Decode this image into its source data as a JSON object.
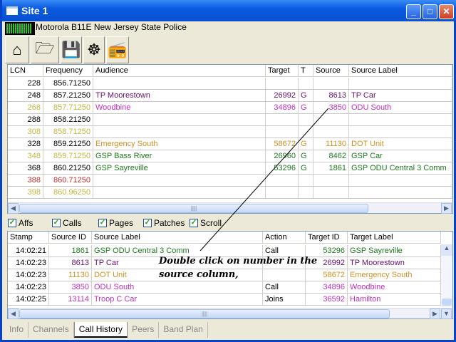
{
  "window": {
    "title": "Site 1"
  },
  "status": {
    "station": "Motorola B11E New Jersey State Police",
    "signal_bars": 12
  },
  "toolbar": [
    {
      "name": "home-icon",
      "glyph": "⌂"
    },
    {
      "name": "folder-open-icon",
      "glyph": "🗁"
    },
    {
      "name": "save-icon",
      "glyph": "💾"
    },
    {
      "name": "wheel-settings-icon",
      "glyph": "☸"
    },
    {
      "name": "radio-scanner-icon",
      "glyph": "📻"
    }
  ],
  "colors": {
    "black": "#000000",
    "purple": "#6a1070",
    "magenta": "#c030c0",
    "yellow": "#c0b840",
    "orange": "#d09020",
    "green": "#1e7a1e",
    "red": "#c03030"
  },
  "channels": {
    "headers": [
      "LCN",
      "Frequency",
      "Audience",
      "Target",
      "T",
      "Source",
      "Source Label"
    ],
    "rows": [
      {
        "cells": [
          "228",
          "856.71250",
          "",
          "",
          "",
          "",
          ""
        ],
        "color": "black",
        "acolor": "black"
      },
      {
        "cells": [
          "248",
          "857.21250",
          "TP Moorestown",
          "26992",
          "G",
          "8613",
          "TP Car"
        ],
        "color": "black",
        "acolor": "purple"
      },
      {
        "cells": [
          "268",
          "857.71250",
          "Woodbine",
          "34896",
          "G",
          "3850",
          "ODU South"
        ],
        "color": "yellow",
        "acolor": "magenta"
      },
      {
        "cells": [
          "288",
          "858.21250",
          "",
          "",
          "",
          "",
          ""
        ],
        "color": "black",
        "acolor": "black"
      },
      {
        "cells": [
          "308",
          "858.71250",
          "",
          "",
          "",
          "",
          ""
        ],
        "color": "yellow",
        "acolor": "black"
      },
      {
        "cells": [
          "328",
          "859.21250",
          "Emergency South",
          "58672",
          "G",
          "11130",
          "DOT Unit"
        ],
        "color": "black",
        "acolor": "orange"
      },
      {
        "cells": [
          "348",
          "859.71250",
          "GSP Bass River",
          "26960",
          "G",
          "8462",
          "GSP Car"
        ],
        "color": "yellow",
        "acolor": "green"
      },
      {
        "cells": [
          "368",
          "860.21250",
          "GSP Sayreville",
          "53296",
          "G",
          "1861",
          "GSP ODU Central 3 Comm"
        ],
        "color": "black",
        "acolor": "green"
      },
      {
        "cells": [
          "388",
          "860.71250",
          "",
          "",
          "",
          "",
          ""
        ],
        "color": "red",
        "acolor": "black"
      },
      {
        "cells": [
          "398",
          "860.96250",
          "",
          "",
          "",
          "",
          ""
        ],
        "color": "yellow",
        "acolor": "black"
      }
    ]
  },
  "filters": [
    {
      "label": "Affs",
      "checked": true
    },
    {
      "label": "Calls",
      "checked": true
    },
    {
      "label": "Pages",
      "checked": true
    },
    {
      "label": "Patches",
      "checked": true
    },
    {
      "label": "Scroll",
      "checked": true
    }
  ],
  "history": {
    "headers": [
      "Stamp",
      "Source ID",
      "Source Label",
      "Action",
      "Target ID",
      "Target Label"
    ],
    "rows": [
      {
        "cells": [
          "14:02:21",
          "1861",
          "GSP ODU Central 3 Comm",
          "Call",
          "53296",
          "GSP Sayreville"
        ],
        "scolor": "green",
        "tcolor": "green"
      },
      {
        "cells": [
          "14:02:23",
          "8613",
          "TP Car",
          "",
          "26992",
          "TP Moorestown"
        ],
        "scolor": "purple",
        "tcolor": "purple"
      },
      {
        "cells": [
          "14:02:23",
          "11130",
          "DOT Unit",
          "",
          "58672",
          "Emergency South"
        ],
        "scolor": "orange",
        "tcolor": "orange"
      },
      {
        "cells": [
          "14:02:23",
          "3850",
          "ODU South",
          "Call",
          "34896",
          "Woodbine"
        ],
        "scolor": "magenta",
        "tcolor": "magenta"
      },
      {
        "cells": [
          "14:02:25",
          "13114",
          "Troop C Car",
          "Joins",
          "36592",
          "Hamilton"
        ],
        "scolor": "magenta",
        "tcolor": "magenta"
      }
    ]
  },
  "tabs": [
    {
      "label": "Info"
    },
    {
      "label": "Channels"
    },
    {
      "label": "Call History",
      "active": true
    },
    {
      "label": "Peers"
    },
    {
      "label": "Band Plan"
    }
  ],
  "annotation": {
    "text": "Double click on number in the source column,"
  }
}
